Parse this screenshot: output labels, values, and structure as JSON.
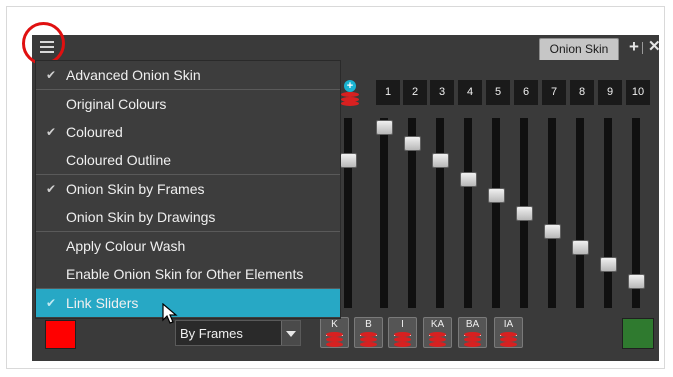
{
  "panel_tab": {
    "label": "Onion Skin"
  },
  "menu": {
    "items": [
      {
        "label": "Advanced Onion Skin",
        "checked": true
      },
      {
        "label": "Original Colours",
        "checked": false
      },
      {
        "label": "Coloured",
        "checked": true
      },
      {
        "label": "Coloured Outline",
        "checked": false
      },
      {
        "label": "Onion Skin by Frames",
        "checked": true
      },
      {
        "label": "Onion Skin by Drawings",
        "checked": false
      },
      {
        "label": "Apply Colour Wash",
        "checked": false
      },
      {
        "label": "Enable Onion Skin for Other Elements",
        "checked": false
      },
      {
        "label": "Link Sliders",
        "checked": true
      }
    ],
    "check_glyph": "✔"
  },
  "slots": {
    "labels": [
      "1",
      "2",
      "3",
      "4",
      "5",
      "6",
      "7",
      "8",
      "9",
      "10"
    ]
  },
  "dropdown": {
    "value": "By Frames"
  },
  "mode_buttons": [
    {
      "label": "K"
    },
    {
      "label": "B"
    },
    {
      "label": "I"
    },
    {
      "label": "KA"
    },
    {
      "label": "BA"
    },
    {
      "label": "IA"
    }
  ],
  "colors": {
    "previous_frames": "#ff0000",
    "next_frames": "#2f7a2f",
    "selection": "#27a8c5",
    "highlight_circle": "#e01010"
  },
  "icons": {
    "menu": "hamburger-icon",
    "add": "plus-icon",
    "close": "close-icon",
    "add_slot": "plus-circle-icon"
  }
}
